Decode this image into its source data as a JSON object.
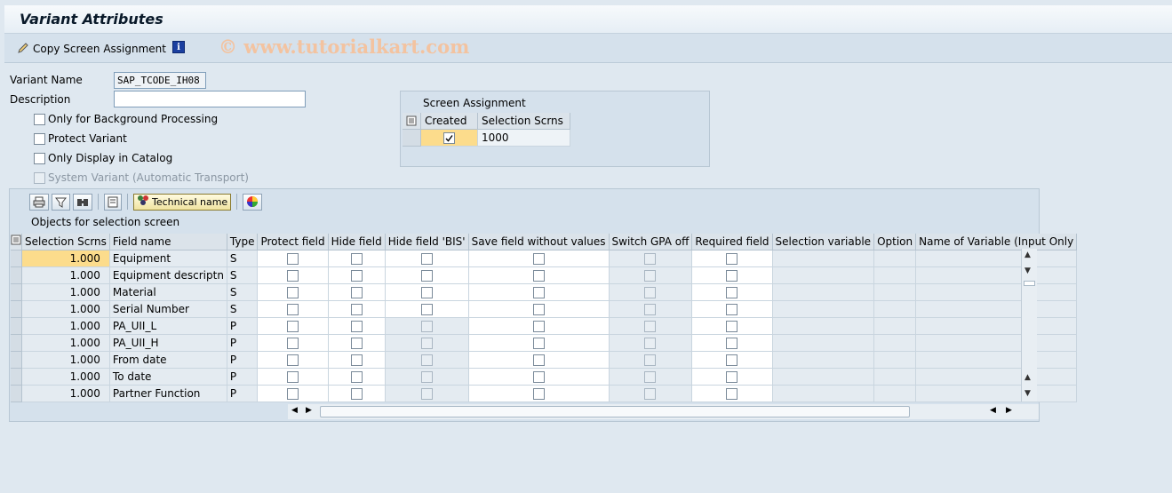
{
  "window": {
    "title": "Variant Attributes"
  },
  "toolbar": {
    "copy_screen_assignment": "Copy Screen Assignment"
  },
  "watermark": "© www.tutorialkart.com",
  "form": {
    "variant_name_label": "Variant Name",
    "variant_name_value": "SAP_TCODE_IH08",
    "description_label": "Description",
    "description_value": "",
    "only_background": "Only for Background Processing",
    "protect_variant": "Protect Variant",
    "only_display_catalog": "Only Display in Catalog",
    "system_variant": "System Variant (Automatic Transport)"
  },
  "screen_assignment": {
    "title": "Screen Assignment",
    "col_created": "Created",
    "col_selection": "Selection Scrns",
    "row_value": "1000"
  },
  "objects": {
    "technical_name_button": "Technical name",
    "title": "Objects for selection screen",
    "headers": [
      "Selection Scrns",
      "Field name",
      "Type",
      "Protect field",
      "Hide field",
      "Hide field 'BIS'",
      "Save field without values",
      "Switch GPA off",
      "Required field",
      "Selection variable",
      "Option",
      "Name of Variable (Input Only"
    ],
    "rows": [
      {
        "scr": "1.000",
        "field": "Equipment",
        "type": "S"
      },
      {
        "scr": "1.000",
        "field": "Equipment descriptn",
        "type": "S"
      },
      {
        "scr": "1.000",
        "field": "Material",
        "type": "S"
      },
      {
        "scr": "1.000",
        "field": "Serial Number",
        "type": "S"
      },
      {
        "scr": "1.000",
        "field": "PA_UII_L",
        "type": "P"
      },
      {
        "scr": "1.000",
        "field": "PA_UII_H",
        "type": "P"
      },
      {
        "scr": "1.000",
        "field": "From date",
        "type": "P"
      },
      {
        "scr": "1.000",
        "field": "To date",
        "type": "P"
      },
      {
        "scr": "1.000",
        "field": "Partner Function",
        "type": "P"
      }
    ]
  }
}
